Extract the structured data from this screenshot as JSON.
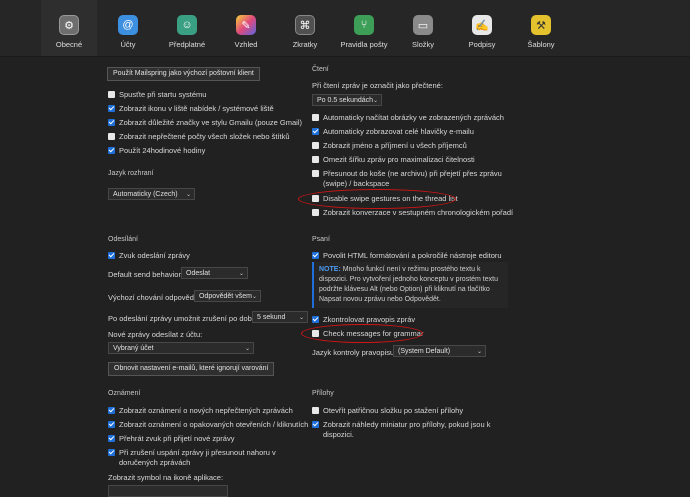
{
  "tabs": [
    {
      "label": "Obecné",
      "icon": "gear-icon",
      "bg": "#6e6e6e"
    },
    {
      "label": "Účty",
      "icon": "at-icon",
      "bg": "#3d8fe0"
    },
    {
      "label": "Předplatné",
      "icon": "person-icon",
      "bg": "#3aa083"
    },
    {
      "label": "Vzhled",
      "icon": "palette-icon",
      "bg": "#d04fa5"
    },
    {
      "label": "Zkratky",
      "icon": "command-key-icon",
      "bg": "#505050"
    },
    {
      "label": "Pravidla pošty",
      "icon": "mail-rules-icon",
      "bg": "#3d9e58"
    },
    {
      "label": "Složky",
      "icon": "folder-icon",
      "bg": "#8a8a8a"
    },
    {
      "label": "Podpisy",
      "icon": "signature-icon",
      "bg": "#e8e8e8"
    },
    {
      "label": "Šablony",
      "icon": "template-icon",
      "bg": "#e3c22d"
    }
  ],
  "left": {
    "default_client_button": "Použít Mailspring jako výchozí poštovní klient",
    "general_items": [
      {
        "label": "Spusťte při startu systému",
        "checked": false
      },
      {
        "label": "Zobrazit ikonu v liště nabídek / systémové liště",
        "checked": true
      },
      {
        "label": "Zobrazit důležité značky ve stylu Gmailu (pouze Gmail)",
        "checked": true
      },
      {
        "label": "Zobrazit nepřečtené počty všech složek nebo štítků",
        "checked": false
      },
      {
        "label": "Použít 24hodinové hodiny",
        "checked": true
      }
    ],
    "language_section": "Jazyk rozhraní",
    "language_value": "Automaticky (Czech)",
    "sending_section": "Odesílání",
    "send_sound": "Zvuk odeslání zprávy",
    "default_send_behavior_label": "Default send behavior:",
    "default_send_behavior_value": "Odeslat",
    "reply_behavior_label": "Výchozí chování odpovědi:",
    "reply_behavior_value": "Odpovědět všem",
    "undo_send_label": "Po odeslání zprávy umožnit zrušení po dobu:",
    "undo_send_value": "5 sekund",
    "send_from_label": "Nové zprávy odesílat z účtu:",
    "send_from_value": "Vybraný účet",
    "reset_button": "Obnovit nastavení e-mailů, které ignorují varování",
    "notifications_section": "Oznámení",
    "notification_items": [
      {
        "label": "Zobrazit oznámení o nových nepřečtených zprávách",
        "checked": true
      },
      {
        "label": "Zobrazit oznámení o opakovaných otevřeních / kliknutích",
        "checked": true
      },
      {
        "label": "Přehrát zvuk při přijetí nové zprávy",
        "checked": true
      },
      {
        "label": "Při zrušení uspání zprávy ji přesunout nahoru v doručených zprávách",
        "checked": true
      }
    ],
    "badge_label": "Zobrazit symbol na ikoně aplikace:"
  },
  "right": {
    "reading_section": "Čtení",
    "mark_read_label": "Při čtení zpráv je označit jako přečtené:",
    "mark_read_value": "Po 0.5 sekundách",
    "reading_items": [
      {
        "label": "Automaticky načítat obrázky ve zobrazených zprávách",
        "checked": false
      },
      {
        "label": "Automaticky zobrazovat celé hlavičky e-mailu",
        "checked": true
      },
      {
        "label": "Zobrazit jméno a příjmení u všech příjemců",
        "checked": false
      },
      {
        "label": "Omezit šířku zpráv pro maximalizaci čitelnosti",
        "checked": false
      },
      {
        "label": "Přesunout do koše (ne archivu) při přejetí přes zprávu (swipe) / backspace",
        "checked": false
      },
      {
        "label": "Disable swipe gestures on the thread list",
        "checked": false
      },
      {
        "label": "Zobrazit konverzace v sestupném chronologickém pořadí",
        "checked": false
      }
    ],
    "writing_section": "Psaní",
    "html_editor": "Povolit HTML formátování a pokročilé nástroje editoru",
    "note_prefix": "NOTE:",
    "note_text": " Mnoho funkcí není v režimu prostého textu k dispozici. Pro vytvoření jednoho konceptu v prostém textu podržte klávesu Alt (nebo Option) při kliknutí na tlačítko Napsat novou zprávu nebo Odpovědět.",
    "spellcheck": "Zkontrolovat pravopis zpráv",
    "grammar": "Check messages for grammar",
    "spell_lang_label": "Jazyk kontroly pravopisu:",
    "spell_lang_value": "(System Default)",
    "attachments_section": "Přílohy",
    "attachment_items": [
      {
        "label": "Otevřít patřičnou složku po stažení přílohy",
        "checked": false
      },
      {
        "label": "Zobrazit náhledy miniatur pro přílohy, pokud jsou k dispozici.",
        "checked": true
      }
    ]
  },
  "accent_color": "#1e6fd9",
  "annotation_color": "#d01515"
}
